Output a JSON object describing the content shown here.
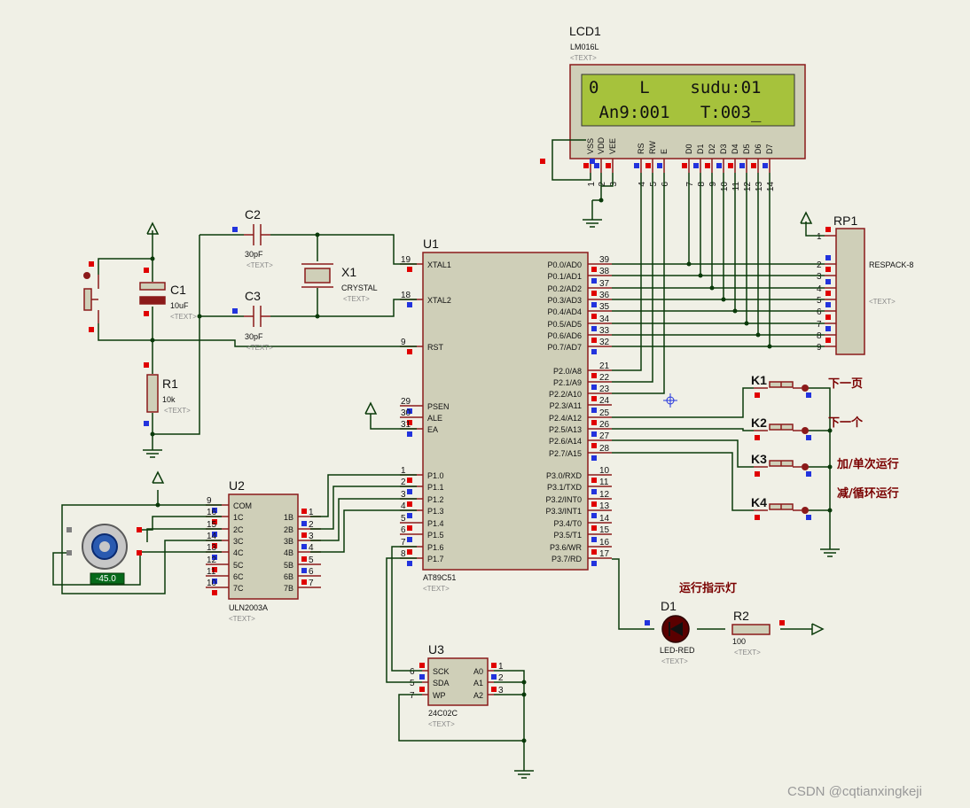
{
  "lcd": {
    "ref": "LCD1",
    "model": "LM016L",
    "text": "<TEXT>",
    "line1": "0    L    sudu:01",
    "line2": " An9:001   T:003_",
    "pins": [
      "VSS",
      "VDD",
      "VEE",
      "RS",
      "RW",
      "E",
      "D0",
      "D1",
      "D2",
      "D3",
      "D4",
      "D5",
      "D6",
      "D7"
    ],
    "pin_numbers": [
      "1",
      "2",
      "3",
      "4",
      "5",
      "6",
      "7",
      "8",
      "9",
      "10",
      "11",
      "12",
      "13",
      "14"
    ]
  },
  "u1": {
    "ref": "U1",
    "part": "AT89C51",
    "text": "<TEXT>",
    "left_pins": [
      {
        "num": "19",
        "name": "XTAL1"
      },
      {
        "num": "18",
        "name": "XTAL2"
      },
      {
        "num": "9",
        "name": "RST"
      },
      {
        "num": "29",
        "name": "PSEN"
      },
      {
        "num": "30",
        "name": "ALE"
      },
      {
        "num": "31",
        "name": "EA"
      },
      {
        "num": "1",
        "name": "P1.0"
      },
      {
        "num": "2",
        "name": "P1.1"
      },
      {
        "num": "3",
        "name": "P1.2"
      },
      {
        "num": "4",
        "name": "P1.3"
      },
      {
        "num": "5",
        "name": "P1.4"
      },
      {
        "num": "6",
        "name": "P1.5"
      },
      {
        "num": "7",
        "name": "P1.6"
      },
      {
        "num": "8",
        "name": "P1.7"
      }
    ],
    "right_pins": [
      {
        "num": "39",
        "name": "P0.0/AD0"
      },
      {
        "num": "38",
        "name": "P0.1/AD1"
      },
      {
        "num": "37",
        "name": "P0.2/AD2"
      },
      {
        "num": "36",
        "name": "P0.3/AD3"
      },
      {
        "num": "35",
        "name": "P0.4/AD4"
      },
      {
        "num": "34",
        "name": "P0.5/AD5"
      },
      {
        "num": "33",
        "name": "P0.6/AD6"
      },
      {
        "num": "32",
        "name": "P0.7/AD7"
      },
      {
        "num": "21",
        "name": "P2.0/A8"
      },
      {
        "num": "22",
        "name": "P2.1/A9"
      },
      {
        "num": "23",
        "name": "P2.2/A10"
      },
      {
        "num": "24",
        "name": "P2.3/A11"
      },
      {
        "num": "25",
        "name": "P2.4/A12"
      },
      {
        "num": "26",
        "name": "P2.5/A13"
      },
      {
        "num": "27",
        "name": "P2.6/A14"
      },
      {
        "num": "28",
        "name": "P2.7/A15"
      },
      {
        "num": "10",
        "name": "P3.0/RXD"
      },
      {
        "num": "11",
        "name": "P3.1/TXD"
      },
      {
        "num": "12",
        "name": "P3.2/INT0"
      },
      {
        "num": "13",
        "name": "P3.3/INT1"
      },
      {
        "num": "14",
        "name": "P3.4/T0"
      },
      {
        "num": "15",
        "name": "P3.5/T1"
      },
      {
        "num": "16",
        "name": "P3.6/WR"
      },
      {
        "num": "17",
        "name": "P3.7/RD"
      }
    ]
  },
  "rp1": {
    "ref": "RP1",
    "part": "RESPACK-8",
    "text": "<TEXT>",
    "pins": [
      "1",
      "2",
      "3",
      "4",
      "5",
      "6",
      "7",
      "8",
      "9"
    ]
  },
  "c1": {
    "ref": "C1",
    "value": "10uF",
    "text": "<TEXT>"
  },
  "c2": {
    "ref": "C2",
    "value": "30pF",
    "text": "<TEXT>"
  },
  "c3": {
    "ref": "C3",
    "value": "30pF",
    "text": "<TEXT>"
  },
  "x1": {
    "ref": "X1",
    "value": "CRYSTAL",
    "text": "<TEXT>"
  },
  "r1": {
    "ref": "R1",
    "value": "10k",
    "text": "<TEXT>"
  },
  "r2": {
    "ref": "R2",
    "value": "100",
    "text": "<TEXT>"
  },
  "d1": {
    "ref": "D1",
    "part": "LED-RED",
    "text": "<TEXT>"
  },
  "u2": {
    "ref": "U2",
    "part": "ULN2003A",
    "text": "<TEXT>",
    "left_pins": [
      {
        "num": "9",
        "name": "COM"
      },
      {
        "num": "16",
        "name": "1C"
      },
      {
        "num": "15",
        "name": "2C"
      },
      {
        "num": "14",
        "name": "3C"
      },
      {
        "num": "13",
        "name": "4C"
      },
      {
        "num": "12",
        "name": "5C"
      },
      {
        "num": "11",
        "name": "6C"
      },
      {
        "num": "10",
        "name": "7C"
      }
    ],
    "right_pins": [
      {
        "num": "1",
        "name": "1B"
      },
      {
        "num": "2",
        "name": "2B"
      },
      {
        "num": "3",
        "name": "3B"
      },
      {
        "num": "4",
        "name": "4B"
      },
      {
        "num": "5",
        "name": "5B"
      },
      {
        "num": "6",
        "name": "6B"
      },
      {
        "num": "7",
        "name": "7B"
      }
    ]
  },
  "u3": {
    "ref": "U3",
    "part": "24C02C",
    "text": "<TEXT>",
    "left_pins": [
      {
        "num": "6",
        "name": "SCK"
      },
      {
        "num": "5",
        "name": "SDA"
      },
      {
        "num": "7",
        "name": "WP"
      }
    ],
    "right_pins": [
      {
        "num": "1",
        "name": "A0"
      },
      {
        "num": "2",
        "name": "A1"
      },
      {
        "num": "3",
        "name": "A2"
      }
    ]
  },
  "motor": {
    "angle": "-45.0"
  },
  "keys": [
    {
      "ref": "K1",
      "label": "下一页"
    },
    {
      "ref": "K2",
      "label": "下一个"
    },
    {
      "ref": "K3",
      "label": "加/单次运行"
    },
    {
      "ref": "K4",
      "label": "减/循环运行"
    }
  ],
  "indicator_label": "运行指示灯",
  "watermark": "CSDN @cqtianxingkeji",
  "colors": {
    "background": "#f0f0e6",
    "wire": "#0a3a0a",
    "component": "#8b1a1a",
    "lcd_screen": "#a6c23c"
  }
}
